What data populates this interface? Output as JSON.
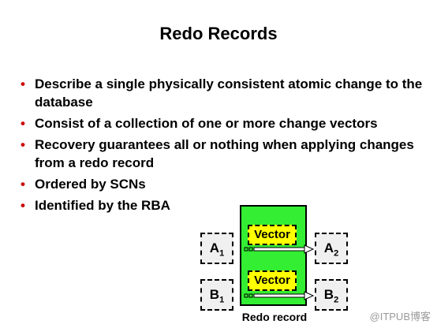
{
  "title": "Redo Records",
  "bullets": [
    "Describe a single physically consistent atomic change to the database",
    "Consist of a collection of one or more change vectors",
    "Recovery guarantees all or nothing when applying changes from a redo record",
    "Ordered by SCNs",
    "Identified by the RBA"
  ],
  "bullet_marker": "•",
  "diagram": {
    "left_boxes": [
      {
        "letter": "A",
        "sub": "1"
      },
      {
        "letter": "B",
        "sub": "1"
      }
    ],
    "right_boxes": [
      {
        "letter": "A",
        "sub": "2"
      },
      {
        "letter": "B",
        "sub": "2"
      }
    ],
    "vectors": [
      "Vector",
      "Vector"
    ],
    "caption": "Redo record",
    "record_color": "#33ee33",
    "vector_color": "#ffff00",
    "bullet_color": "#cc0000"
  },
  "watermark": "@ITPUB博客"
}
